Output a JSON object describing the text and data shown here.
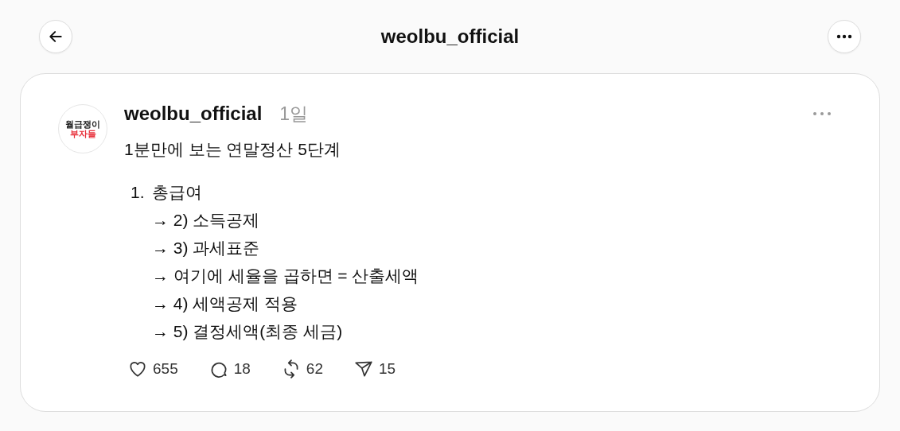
{
  "header": {
    "title": "weolbu_official"
  },
  "post": {
    "avatar": {
      "line_1": "월급쟁이",
      "line_2": "부자들"
    },
    "author": "weolbu_official",
    "time": "1일",
    "text": "1분만에 보는 연말정산 5단계",
    "list": {
      "number": "1.",
      "title": "총급여",
      "steps": [
        "→ 2) 소득공제",
        "→ 3) 과세표준",
        "→ 여기에 세율을 곱하면 = 산출세액",
        "→ 4) 세액공제 적용",
        "→ 5) 결정세액(최종 세금)"
      ]
    },
    "actions": [
      {
        "kind": "like",
        "count": "655"
      },
      {
        "kind": "reply",
        "count": "18"
      },
      {
        "kind": "repost",
        "count": "62"
      },
      {
        "kind": "share",
        "count": "15"
      }
    ]
  }
}
